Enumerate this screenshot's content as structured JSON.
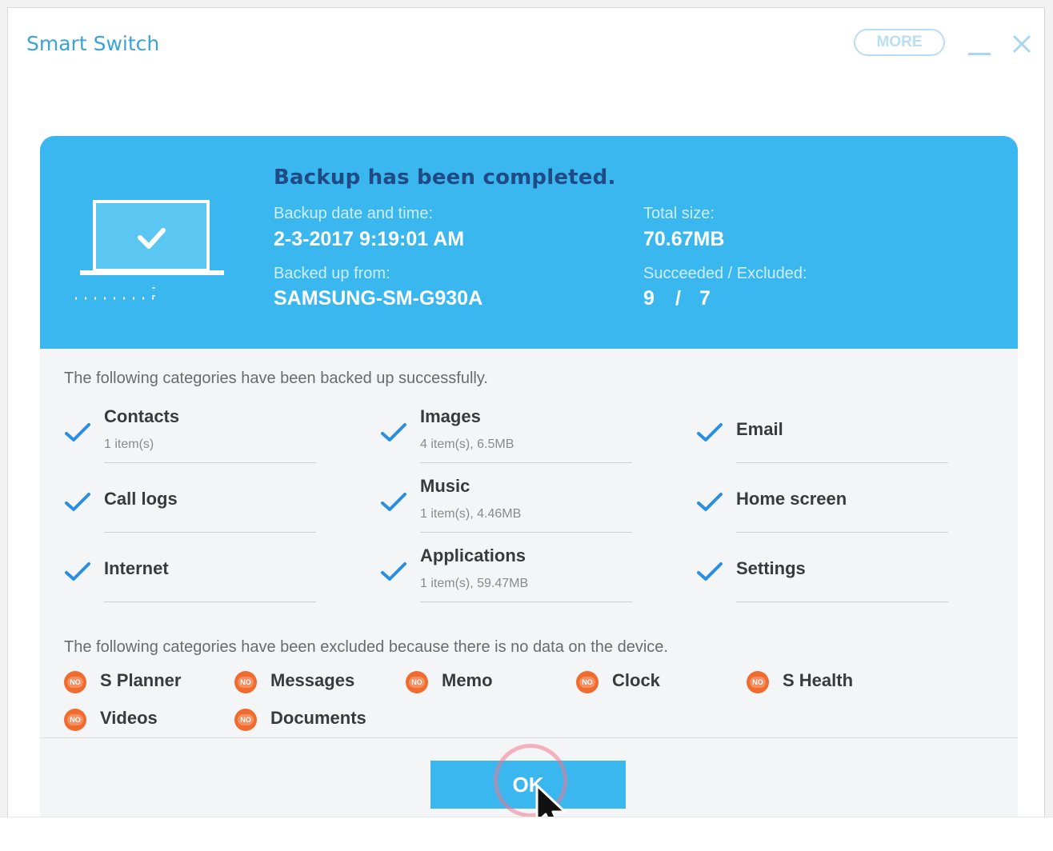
{
  "window": {
    "title": "Smart Switch",
    "more_label": "MORE"
  },
  "banner": {
    "title": "Backup has been completed.",
    "date_label": "Backup date and time:",
    "date_value": "2-3-2017 9:19:01 AM",
    "from_label": "Backed up from:",
    "from_value": "SAMSUNG-SM-G930A",
    "size_label": "Total size:",
    "size_value": "70.67MB",
    "result_label": "Succeeded / Excluded:",
    "succeeded": "9",
    "separator": "/",
    "excluded": "7"
  },
  "backed_up": {
    "label": "The following categories have been backed up successfully.",
    "items": [
      {
        "name": "Contacts",
        "meta": "1 item(s)"
      },
      {
        "name": "Images",
        "meta": "4 item(s), 6.5MB"
      },
      {
        "name": "Email",
        "meta": ""
      },
      {
        "name": "Call logs",
        "meta": ""
      },
      {
        "name": "Music",
        "meta": "1 item(s), 4.46MB"
      },
      {
        "name": "Home screen",
        "meta": ""
      },
      {
        "name": "Internet",
        "meta": ""
      },
      {
        "name": "Applications",
        "meta": "1 item(s), 59.47MB"
      },
      {
        "name": "Settings",
        "meta": ""
      }
    ]
  },
  "excluded": {
    "label": "The following categories have been excluded because there is no data on the device.",
    "badge": "NO",
    "items": [
      "S Planner",
      "Messages",
      "Memo",
      "Clock",
      "S Health",
      "Videos",
      "Documents"
    ]
  },
  "footer": {
    "ok_label": "OK"
  },
  "colors": {
    "accent": "#3bb7ef",
    "title_blue": "#1f4a84",
    "check_blue": "#2a8fe0",
    "excluded_orange": "#f06b2d"
  }
}
